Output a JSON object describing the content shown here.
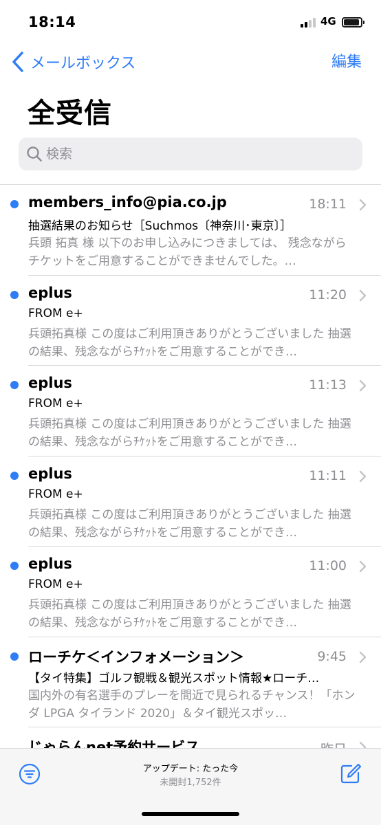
{
  "status_bar": {
    "time": "18:14",
    "network": "4G",
    "battery_level": 0.9
  },
  "nav": {
    "back_label": "メールボックス",
    "edit_label": "編集"
  },
  "page_title": "全受信",
  "search": {
    "placeholder": "検索",
    "value": ""
  },
  "messages": [
    {
      "sender": "members_info@pia.co.jp",
      "time": "18:11",
      "subject": "抽選結果のお知らせ［Suchmos〔神奈川･東京〕］",
      "preview": "兵頭 拓真 様 以下のお申し込みにつきましては、 残念ながらチケットをご用意することができませんでした。…",
      "unread": true
    },
    {
      "sender": "eplus",
      "time": "11:20",
      "subject": "FROM e+",
      "preview": "兵頭拓真様 この度はご利用頂きありがとうございました 抽選の結果、残念ながらﾁｹｯﾄをご用意することができ…",
      "unread": true
    },
    {
      "sender": "eplus",
      "time": "11:13",
      "subject": "FROM e+",
      "preview": "兵頭拓真様 この度はご利用頂きありがとうございました 抽選の結果、残念ながらﾁｹｯﾄをご用意することができ…",
      "unread": true
    },
    {
      "sender": "eplus",
      "time": "11:11",
      "subject": "FROM e+",
      "preview": "兵頭拓真様 この度はご利用頂きありがとうございました 抽選の結果、残念ながらﾁｹｯﾄをご用意することができ…",
      "unread": true
    },
    {
      "sender": "eplus",
      "time": "11:00",
      "subject": "FROM e+",
      "preview": "兵頭拓真様 この度はご利用頂きありがとうございました 抽選の結果、残念ながらﾁｹｯﾄをご用意することができ…",
      "unread": true
    },
    {
      "sender": "ローチケ＜インフォメーション＞",
      "time": "9:45",
      "subject": "【タイ特集】ゴルフ観戦＆観光スポット情報★ローチ…",
      "preview": "国内外の有名選手のプレーを間近で見られるチャンス！「ホンダ LPGA タイランド 2020」＆タイ観光スポッ…",
      "unread": true
    },
    {
      "sender": "じゃらんnet予約サービス",
      "time": "昨日",
      "subject": "",
      "preview": "",
      "unread": false
    }
  ],
  "toolbar": {
    "status": "アップデート: たった今",
    "unread_count": "未開封1,752件"
  },
  "colors": {
    "accent": "#2e7cf6",
    "secondary_text": "#8e8e93",
    "separator": "#d9d9de"
  },
  "icons": {
    "back": "chevron-left-icon",
    "search": "magnifier-icon",
    "filter": "filter-icon",
    "compose": "compose-icon",
    "disclosure": "chevron-right-icon"
  }
}
